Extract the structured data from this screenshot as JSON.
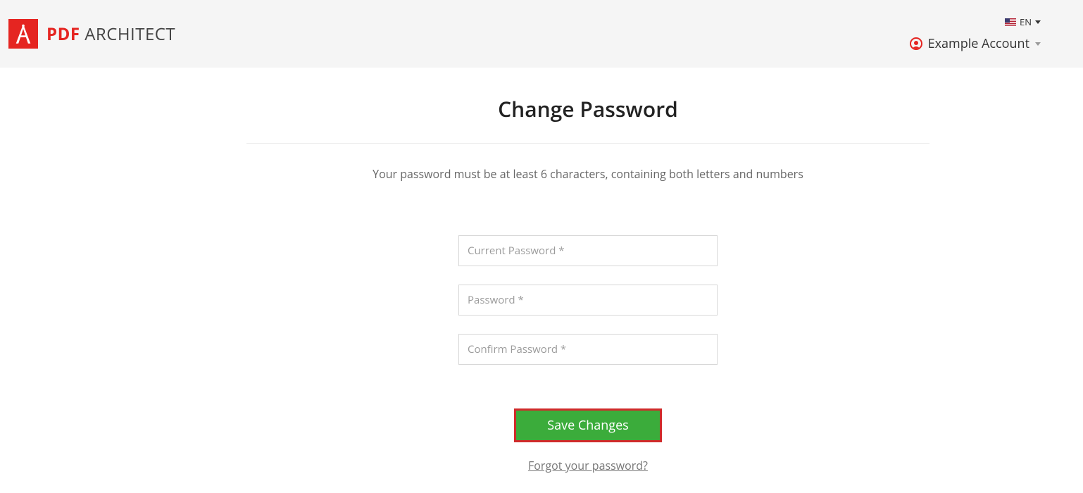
{
  "header": {
    "brand_pdf": "PDF",
    "brand_arch": " ARCHITECT",
    "language_label": "EN",
    "account_name": "Example Account"
  },
  "page": {
    "title": "Change Password",
    "hint": "Your password must be at least 6 characters, containing both letters and numbers"
  },
  "form": {
    "current_password_placeholder": "Current Password *",
    "password_placeholder": "Password *",
    "confirm_password_placeholder": "Confirm Password *",
    "save_label": "Save Changes",
    "forgot_label": "Forgot your password?"
  }
}
